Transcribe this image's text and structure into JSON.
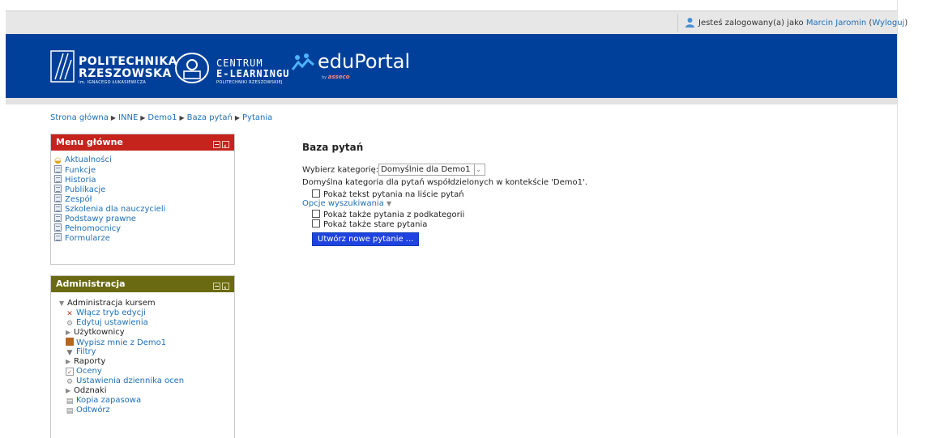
{
  "user": {
    "prefix": "Jesteś zalogowany(a) jako",
    "name": "Marcin Jaromin",
    "logout": "Wyloguj"
  },
  "logos": {
    "pr_line1": "POLITECHNIKA",
    "pr_line2": "RZESZOWSKA",
    "pr_line3": "im. IGNACEGO ŁUKASIEWICZA",
    "ce_line1": "CENTRUM",
    "ce_line2": "E-LEARNINGU",
    "ce_line3": "POLITECHNIKI RZESZOWSKIEJ",
    "ep_name": "eduPortal",
    "ep_by": "by",
    "ep_brand": "asseco"
  },
  "breadcrumb": [
    "Strona główna",
    "INNE",
    "Demo1",
    "Baza pytań",
    "Pytania"
  ],
  "menu": {
    "title": "Menu główne",
    "items": [
      "Aktualności",
      "Funkcje",
      "Historia",
      "Publikacje",
      "Zespół",
      "Szkolenia dla nauczycieli",
      "Podstawy prawne",
      "Pełnomocnicy",
      "Formularze"
    ]
  },
  "admin": {
    "title": "Administracja",
    "section": "Administracja kursem",
    "items": [
      "Włącz tryb edycji",
      "Edytuj ustawienia",
      "Użytkownicy",
      "Wypisz mnie z Demo1",
      "Filtry",
      "Raporty",
      "Oceny",
      "Ustawienia dziennika ocen",
      "Odznaki",
      "Kopia zapasowa",
      "Odtwórz"
    ]
  },
  "main": {
    "heading": "Baza pytań",
    "category_label": "Wybierz kategorię:",
    "category_value": "Domyślnie dla Demo1",
    "category_desc": "Domyślna kategoria dla pytań współdzielonych w kontekście 'Demo1'.",
    "show_text": "Pokaż tekst pytania na liście pytań",
    "search_options": "Opcje wyszukiwania",
    "show_sub": "Pokaż także pytania z podkategorii",
    "show_old": "Pokaż także stare pytania",
    "create_button": "Utwórz nowe pytanie ..."
  },
  "colors": {
    "banner": "#00409a",
    "menu_header": "#c4241c",
    "admin_header": "#6a6a12",
    "link": "#1f6fb8",
    "button": "#1f43e0"
  }
}
